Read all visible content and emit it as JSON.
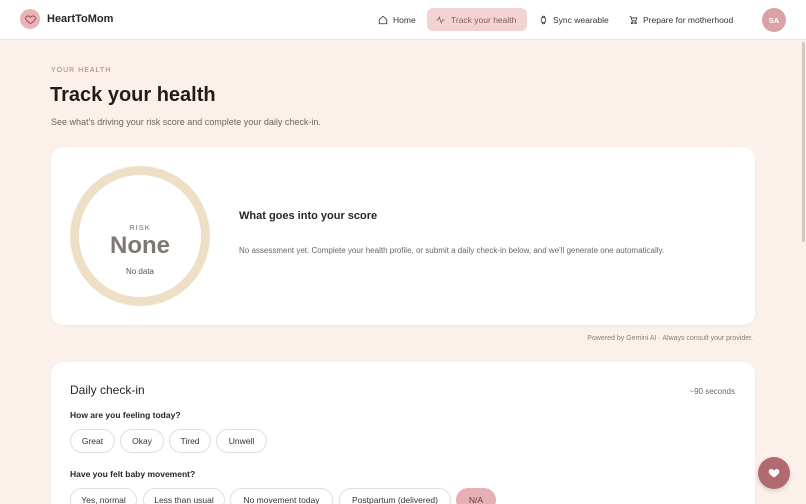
{
  "app": {
    "name": "HeartToMom",
    "logo_icon": "heart-icon"
  },
  "nav": {
    "items": [
      {
        "label": "Home",
        "icon": "home-icon"
      },
      {
        "label": "Track your health",
        "icon": "activity-icon",
        "active": true
      },
      {
        "label": "Sync wearable",
        "icon": "watch-icon"
      },
      {
        "label": "Prepare for motherhood",
        "icon": "baby-stroller-icon"
      }
    ],
    "avatar_initials": "SA"
  },
  "page": {
    "eyebrow": "YOUR HEALTH",
    "title": "Track your health",
    "subtitle": "See what's driving your risk score and complete your daily check-in."
  },
  "risk": {
    "label": "RISK",
    "value": "None",
    "note": "No data",
    "score_title": "What goes into your score",
    "score_desc": "No assessment yet. Complete your health profile, or submit a daily check-in below, and we'll generate one automatically."
  },
  "powered_by": "Powered by Gemini AI · Always consult your provider.",
  "checkin": {
    "title": "Daily check-in",
    "time": "~90 seconds",
    "q1": "How are you feeling today?",
    "q1_options": [
      "Great",
      "Okay",
      "Tired",
      "Unwell"
    ],
    "q2": "Have you felt baby movement?",
    "q2_options": [
      "Yes, normal",
      "Less than usual",
      "No movement today",
      "Postpartum (delivered)",
      "N/A"
    ],
    "q2_selected": "N/A"
  },
  "colors": {
    "accent": "#e6b0b4",
    "background": "#fbf1ea",
    "ring": "#eee0c7",
    "fab": "#b06a70"
  }
}
